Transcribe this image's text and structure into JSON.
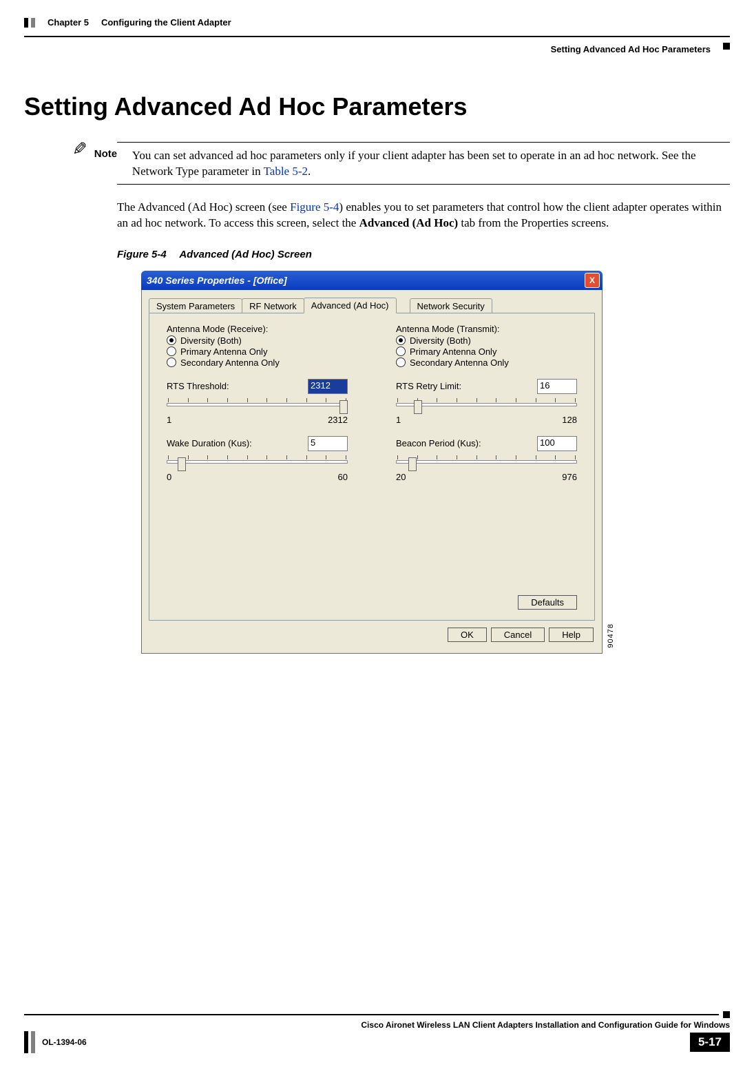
{
  "header": {
    "chapter": "Chapter 5",
    "chapter_title": "Configuring the Client Adapter",
    "section_right": "Setting Advanced Ad Hoc Parameters"
  },
  "h1": "Setting Advanced Ad Hoc Parameters",
  "note": {
    "label": "Note",
    "text_before_link": "You can set advanced ad hoc parameters only if your client adapter has been set to operate in an ad hoc network. See the Network Type parameter in ",
    "link": "Table 5-2",
    "text_after_link": "."
  },
  "para": {
    "part1": "The Advanced (Ad Hoc) screen (see ",
    "link": "Figure 5-4",
    "part2": ") enables you to set parameters that control how the client adapter operates within an ad hoc network. To access this screen, select the ",
    "bold": "Advanced (Ad Hoc)",
    "part3": " tab from the Properties screens."
  },
  "figure": {
    "num": "Figure 5-4",
    "title": "Advanced (Ad Hoc) Screen",
    "side_id": "90478"
  },
  "dialog": {
    "title": "340 Series Properties - [Office]",
    "close_glyph": "X",
    "tabs": {
      "sys": "System Parameters",
      "rf": "RF Network",
      "adv": "Advanced (Ad Hoc)",
      "net": "Network Security"
    },
    "antenna_rx": {
      "label": "Antenna Mode (Receive):",
      "opt1": "Diversity (Both)",
      "opt2": "Primary Antenna Only",
      "opt3": "Secondary Antenna Only"
    },
    "antenna_tx": {
      "label": "Antenna Mode (Transmit):",
      "opt1": "Diversity (Both)",
      "opt2": "Primary Antenna Only",
      "opt3": "Secondary Antenna Only"
    },
    "rts_threshold": {
      "label": "RTS Threshold:",
      "value": "2312",
      "min": "1",
      "max": "2312"
    },
    "rts_retry": {
      "label": "RTS Retry Limit:",
      "value": "16",
      "min": "1",
      "max": "128"
    },
    "wake": {
      "label": "Wake Duration (Kus):",
      "value": "5",
      "min": "0",
      "max": "60"
    },
    "beacon": {
      "label": "Beacon Period (Kus):",
      "value": "100",
      "min": "20",
      "max": "976"
    },
    "buttons": {
      "defaults": "Defaults",
      "ok": "OK",
      "cancel": "Cancel",
      "help": "Help"
    }
  },
  "footer": {
    "book": "Cisco Aironet Wireless LAN Client Adapters Installation and Configuration Guide for Windows",
    "doc_id": "OL-1394-06",
    "page": "5-17"
  }
}
